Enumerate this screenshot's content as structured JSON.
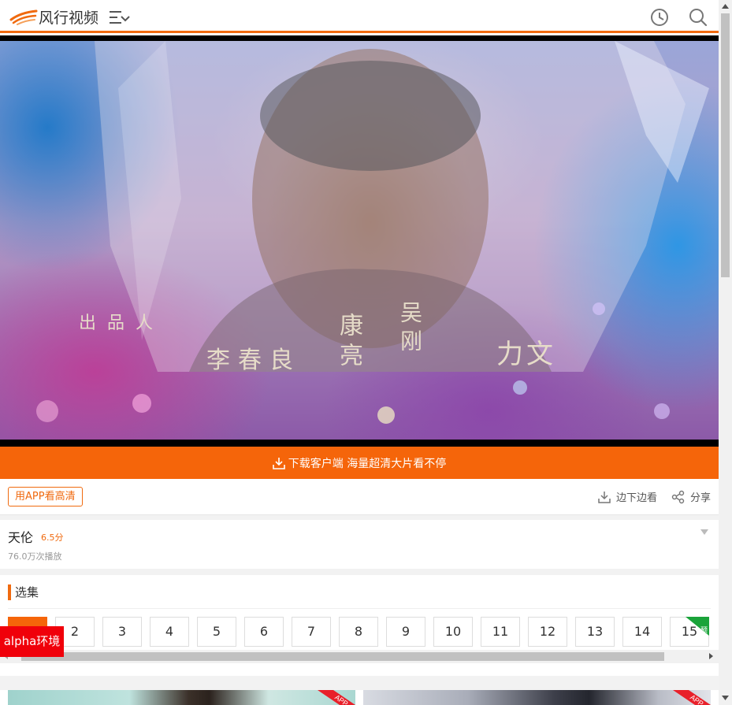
{
  "header": {
    "logo_text": "风行视频",
    "icons": [
      "logo-icon",
      "menu-icon",
      "history-icon",
      "search-icon"
    ]
  },
  "player": {
    "credits": [
      "出品人",
      "李春良",
      "康亮",
      "吴刚",
      "力文"
    ]
  },
  "download_banner": {
    "text": "下载客户端 海量超清大片看不停",
    "icon": "download-icon"
  },
  "actions": {
    "app_hd_label": "用APP看高清",
    "side_watch_label": "边下边看",
    "share_label": "分享"
  },
  "info": {
    "title": "天伦",
    "score": "6.5分",
    "plays": "76.0万次播放"
  },
  "episodes": {
    "heading": "选集",
    "items": [
      "",
      "2",
      "3",
      "4",
      "5",
      "6",
      "7",
      "8",
      "9",
      "10",
      "11",
      "12",
      "13",
      "14",
      "15"
    ],
    "preview_badge": "预",
    "active_index": 0
  },
  "env_tag": "alpha环境",
  "recommendations": {
    "badge": "APP"
  },
  "colors": {
    "accent": "#f5650a",
    "env_tag": "#f0000a",
    "preview_badge": "#1aa33a"
  }
}
